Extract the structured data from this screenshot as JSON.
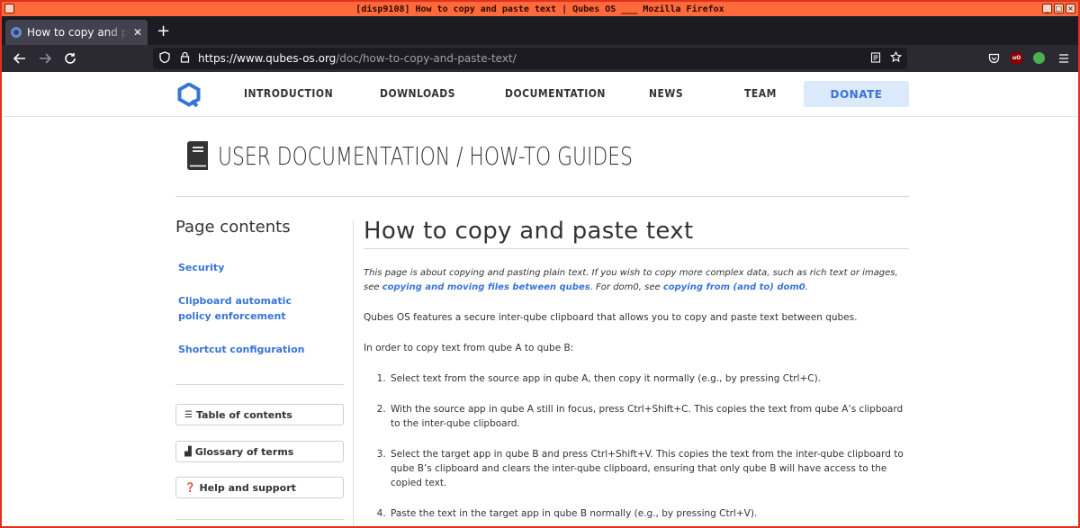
{
  "window": {
    "title": "[disp9108] How to copy and paste text | Qubes OS ___ Mozilla Firefox",
    "btn_min": "_",
    "btn_max": "□",
    "btn_close": "×"
  },
  "browser": {
    "tab_label": "How to copy and paste text | Qubes OS",
    "tab_close": "✕",
    "new_tab": "+",
    "url_domain": "https://www.qubes-os.org",
    "url_path": "/doc/how-to-copy-and-paste-text/",
    "ext_ublock": "uO"
  },
  "site_nav": {
    "items": [
      "INTRODUCTION",
      "DOWNLOADS",
      "DOCUMENTATION",
      "NEWS",
      "TEAM"
    ],
    "donate": "DONATE"
  },
  "docs_header": {
    "title": "USER DOCUMENTATION / HOW-TO GUIDES"
  },
  "sidebar": {
    "heading": "Page contents",
    "links": [
      "Security",
      "Clipboard automatic policy enforcement",
      "Shortcut configuration"
    ],
    "buttons": [
      "Table of contents",
      "Glossary of terms",
      "Help and support"
    ]
  },
  "article": {
    "title": "How to copy and paste text",
    "intro_1": "This page is about copying and pasting plain text. If you wish to copy more complex data, such as rich text or images, see ",
    "intro_link_1": "copying and moving files between qubes",
    "intro_2": ". For dom0, see ",
    "intro_link_2": "copying from (and to) dom0",
    "intro_3": ".",
    "para_1": "Qubes OS features a secure inter-qube clipboard that allows you to copy and paste text between qubes.",
    "para_2": "In order to copy text from qube A to qube B:",
    "steps": [
      "Select text from the source app in qube A, then copy it normally (e.g., by pressing Ctrl+C).",
      "With the source app in qube A still in focus, press Ctrl+Shift+C. This copies the text from qube A’s clipboard to the inter-qube clipboard.",
      "Select the target app in qube B and press Ctrl+Shift+V. This copies the text from the inter-qube clipboard to qube B’s clipboard and clears the inter-qube clipboard, ensuring that only qube B will have access to the copied text.",
      "Paste the text in the target app in qube B normally (e.g., by pressing Ctrl+V)."
    ]
  },
  "colors": {
    "accent": "#3874d8",
    "window_border": "#e0311c",
    "titlebar": "#ff6a3d"
  }
}
